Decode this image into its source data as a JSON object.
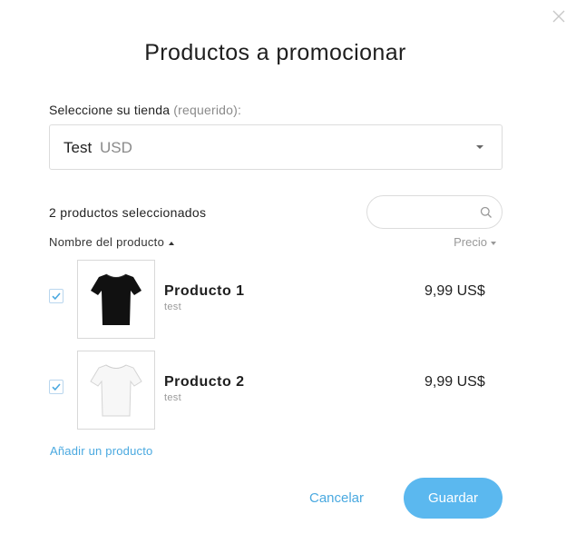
{
  "dialog": {
    "title": "Productos a promocionar",
    "close_icon": "close-icon"
  },
  "store": {
    "label": "Seleccione su tienda",
    "required": "(requerido):",
    "selected_name": "Test",
    "selected_currency": "USD"
  },
  "products": {
    "count_text": "2 productos seleccionados",
    "search_placeholder": "",
    "col_name": "Nombre del producto",
    "col_price": "Precio",
    "items": [
      {
        "name": "Producto 1",
        "subtitle": "test",
        "price": "9,99 US$",
        "checked": true,
        "shirt_color": "#111111"
      },
      {
        "name": "Producto 2",
        "subtitle": "test",
        "price": "9,99 US$",
        "checked": true,
        "shirt_color": "#f7f7f7"
      }
    ],
    "add_link": "Añadir un producto"
  },
  "actions": {
    "cancel": "Cancelar",
    "save": "Guardar"
  },
  "colors": {
    "accent": "#4aa9e0",
    "button_bg": "#5bb8ef"
  }
}
